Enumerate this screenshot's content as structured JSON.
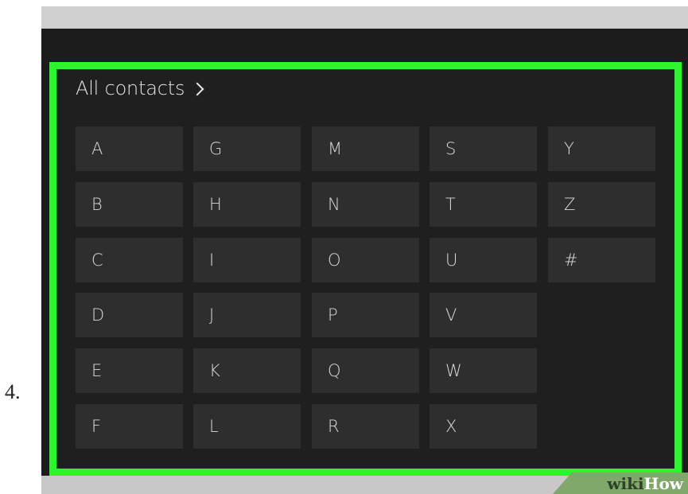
{
  "step_number": "4.",
  "header": {
    "title": "All contacts"
  },
  "colors": {
    "highlight_border": "#2df52d",
    "tile_bg": "#2e2e2e",
    "panel_bg": "#1f1f1f"
  },
  "letters": {
    "A": "A",
    "B": "B",
    "C": "C",
    "D": "D",
    "E": "E",
    "F": "F",
    "G": "G",
    "H": "H",
    "I": "I",
    "J": "J",
    "K": "K",
    "L": "L",
    "M": "M",
    "N": "N",
    "O": "O",
    "P": "P",
    "Q": "Q",
    "R": "R",
    "S": "S",
    "T": "T",
    "U": "U",
    "V": "V",
    "W": "W",
    "X": "X",
    "Y": "Y",
    "Z": "Z",
    "hash": "#"
  },
  "watermark": {
    "part1": "wiki",
    "part2": "How"
  }
}
